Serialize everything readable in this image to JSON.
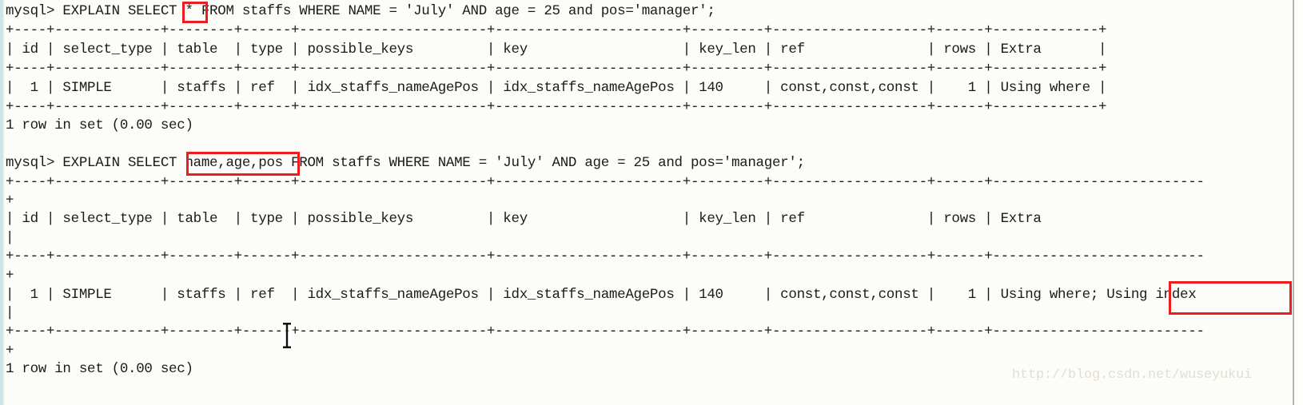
{
  "terminal": {
    "app": "mysql-client-console",
    "prompt": "mysql>",
    "background_color": "#fcfcf8",
    "text_color": "#1b1b1b",
    "annotation_color": "#ee1c1c",
    "watermark": "http://blog.csdn.net/wuseyukui",
    "cursor": "i-beam-text-cursor"
  },
  "sessions": [
    {
      "id": "query-1",
      "command": "mysql> EXPLAIN SELECT * FROM staffs WHERE NAME = 'July' AND age = 25 and pos='manager';",
      "highlight": "*",
      "table": {
        "columns": [
          "id",
          "select_type",
          "table",
          "type",
          "possible_keys",
          "key",
          "key_len",
          "ref",
          "rows",
          "Extra"
        ],
        "rows": [
          [
            "1",
            "SIMPLE",
            "staffs",
            "ref",
            "idx_staffs_nameAgePos",
            "idx_staffs_nameAgePos",
            "140",
            "const,const,const",
            "1",
            "Using where"
          ]
        ]
      },
      "result": "1 row in set (0.00 sec)"
    },
    {
      "id": "query-2",
      "command": "mysql> EXPLAIN SELECT name,age,pos FROM staffs WHERE NAME = 'July' AND age = 25 and pos='manager';",
      "highlight": "name,age,pos",
      "table": {
        "columns": [
          "id",
          "select_type",
          "table",
          "type",
          "possible_keys",
          "key",
          "key_len",
          "ref",
          "rows",
          "Extra"
        ],
        "rows": [
          [
            "1",
            "SIMPLE",
            "staffs",
            "ref",
            "idx_staffs_nameAgePos",
            "idx_staffs_nameAgePos",
            "140",
            "const,const,const",
            "1",
            "Using where; Using index"
          ]
        ]
      },
      "result": "1 row in set (0.00 sec)",
      "extra_highlight": "Using index"
    }
  ],
  "lines": [
    "mysql> EXPLAIN SELECT * FROM staffs WHERE NAME = 'July' AND age = 25 and pos='manager';",
    "+----+-------------+--------+------+-----------------------+-----------------------+---------+-------------------+------+-------------+",
    "| id | select_type | table  | type | possible_keys         | key                   | key_len | ref               | rows | Extra       |",
    "+----+-------------+--------+------+-----------------------+-----------------------+---------+-------------------+------+-------------+",
    "|  1 | SIMPLE      | staffs | ref  | idx_staffs_nameAgePos | idx_staffs_nameAgePos | 140     | const,const,const |    1 | Using where |",
    "+----+-------------+--------+------+-----------------------+-----------------------+---------+-------------------+------+-------------+",
    "1 row in set (0.00 sec)",
    "",
    "mysql> EXPLAIN SELECT name,age,pos FROM staffs WHERE NAME = 'July' AND age = 25 and pos='manager';",
    "+----+-------------+--------+------+-----------------------+-----------------------+---------+-------------------+------+--------------------------",
    "+",
    "| id | select_type | table  | type | possible_keys         | key                   | key_len | ref               | rows | Extra                    ",
    "|",
    "+----+-------------+--------+------+-----------------------+-----------------------+---------+-------------------+------+--------------------------",
    "+",
    "|  1 | SIMPLE      | staffs | ref  | idx_staffs_nameAgePos | idx_staffs_nameAgePos | 140     | const,const,const |    1 | Using where; Using index ",
    "|",
    "+----+-------------+--------+------+-----------------------+-----------------------+---------+-------------------+------+--------------------------",
    "+",
    "1 row in set (0.00 sec)"
  ]
}
